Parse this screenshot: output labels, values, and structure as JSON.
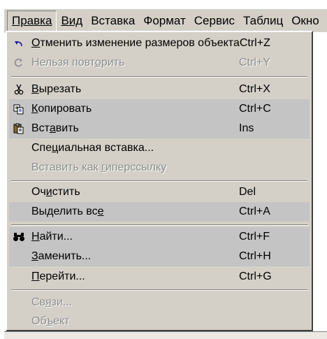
{
  "menubar": {
    "items": [
      "Правка",
      "Вид",
      "Вставка",
      "Формат",
      "Сервис",
      "Таблиц",
      "Окно"
    ]
  },
  "menu": {
    "undo": {
      "label_pre": "",
      "label_u": "О",
      "label_post": "тменить изменение размеров объекта",
      "shortcut": "Ctrl+Z"
    },
    "redo": {
      "label_pre": "Нельзя повт",
      "label_u": "о",
      "label_post": "рить",
      "shortcut": "Ctrl+Y"
    },
    "cut": {
      "label_pre": "",
      "label_u": "В",
      "label_post": "ырезать",
      "shortcut": "Ctrl+X"
    },
    "copy": {
      "label_pre": "",
      "label_u": "К",
      "label_post": "опировать",
      "shortcut": "Ctrl+C"
    },
    "paste": {
      "label_pre": "Вст",
      "label_u": "а",
      "label_post": "вить",
      "shortcut": "Ins"
    },
    "paste_special": {
      "label_pre": "Спе",
      "label_u": "ц",
      "label_post": "иальная вставка...",
      "shortcut": ""
    },
    "paste_hyperlink": {
      "label_pre": "Вставить как ",
      "label_u": "г",
      "label_post": "иперссылку",
      "shortcut": ""
    },
    "clear": {
      "label_pre": "Оч",
      "label_u": "и",
      "label_post": "стить",
      "shortcut": "Del"
    },
    "select_all": {
      "label_pre": "Выделить вс",
      "label_u": "е",
      "label_post": "",
      "shortcut": "Ctrl+A"
    },
    "find": {
      "label_pre": "",
      "label_u": "Н",
      "label_post": "айти...",
      "shortcut": "Ctrl+F"
    },
    "replace": {
      "label_pre": "",
      "label_u": "З",
      "label_post": "аменить...",
      "shortcut": "Ctrl+H"
    },
    "goto": {
      "label_pre": "",
      "label_u": "П",
      "label_post": "ерейти...",
      "shortcut": "Ctrl+G"
    },
    "links": {
      "label_pre": "Св",
      "label_u": "я",
      "label_post": "зи...",
      "shortcut": ""
    },
    "object": {
      "label_pre": "Об",
      "label_u": "ъ",
      "label_post": "ект",
      "shortcut": ""
    }
  },
  "colors": {
    "menu_bg": "#d4d0c8",
    "band": "#c4c4c4",
    "disabled_text": "#8c8c8c"
  },
  "icons": {
    "undo": "undo-arrow-icon",
    "redo": "redo-arrow-icon",
    "cut": "scissors-icon",
    "copy": "copy-icon",
    "paste": "clipboard-icon",
    "find": "binoculars-icon"
  }
}
